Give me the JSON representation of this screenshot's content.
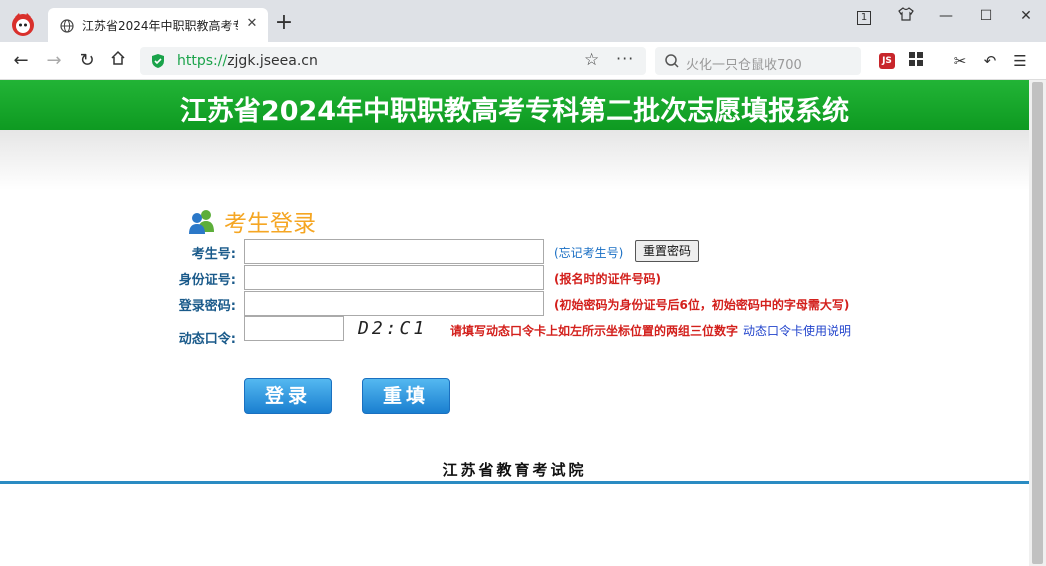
{
  "browser": {
    "tab_title": "江苏省2024年中职职教高考专",
    "url_host": "https://",
    "url_domain": "zjgk.jseea.cn",
    "search_placeholder": "火化一只仓鼠收700",
    "window_counter": "1"
  },
  "page": {
    "banner_title": "江苏省2024年中职职教高考专科第二批次志愿填报系统",
    "login_title": "考生登录",
    "fields": {
      "exam_no_label": "考生号:",
      "id_no_label": "身份证号:",
      "password_label": "登录密码:",
      "otp_label": "动态口令:"
    },
    "hints": {
      "forgot_exam_no": "(忘记考生号)",
      "id_hint": "(报名时的证件号码)",
      "password_hint": "(初始密码为身份证号后6位，初始密码中的字母需大写)",
      "otp_hint": "请填写动态口令卡上如左所示坐标位置的两组三位数字",
      "otp_help_link": "动态口令卡使用说明"
    },
    "reset_password_button": "重置密码",
    "captcha_code": "D2:C1",
    "login_button": "登录",
    "refill_button": "重填",
    "footer_org": "江苏省教育考试院"
  },
  "colors": {
    "banner_green": "#14a52a",
    "title_orange": "#f5a623",
    "label_blue": "#1a5a8a",
    "hint_red": "#d3201c",
    "hint_blue": "#1a6fc4",
    "footer_line": "#2a8bc2"
  }
}
